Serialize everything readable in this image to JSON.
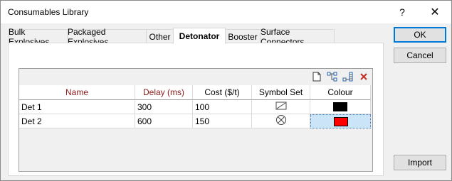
{
  "window": {
    "title": "Consumables Library",
    "help_glyph": "?",
    "close_glyph": "✕"
  },
  "tabs": [
    {
      "label": "Bulk Explosives"
    },
    {
      "label": "Packaged Explosives"
    },
    {
      "label": "Other"
    },
    {
      "label": "Detonator",
      "active": true
    },
    {
      "label": "Booster"
    },
    {
      "label": "Surface Connectors"
    }
  ],
  "grid": {
    "toolbar": [
      "new-icon",
      "hierarchy-icon",
      "tree-expand-icon",
      "delete-icon"
    ],
    "columns": [
      "Name",
      "Delay (ms)",
      "Cost ($/t)",
      "Symbol Set",
      "Colour"
    ],
    "rows": [
      {
        "name": "Det 1",
        "delay": "300",
        "cost": "100",
        "symbol": "rectangle-slash-icon",
        "colour": "#000000"
      },
      {
        "name": "Det 2",
        "delay": "600",
        "cost": "150",
        "symbol": "circle-x-icon",
        "colour": "#ff0000"
      }
    ]
  },
  "buttons": {
    "ok": "OK",
    "cancel": "Cancel",
    "import": "Import"
  },
  "colors": {
    "accent": "#0078d7",
    "header_red": "#8b1a1a",
    "selection": "#cce4f7"
  }
}
